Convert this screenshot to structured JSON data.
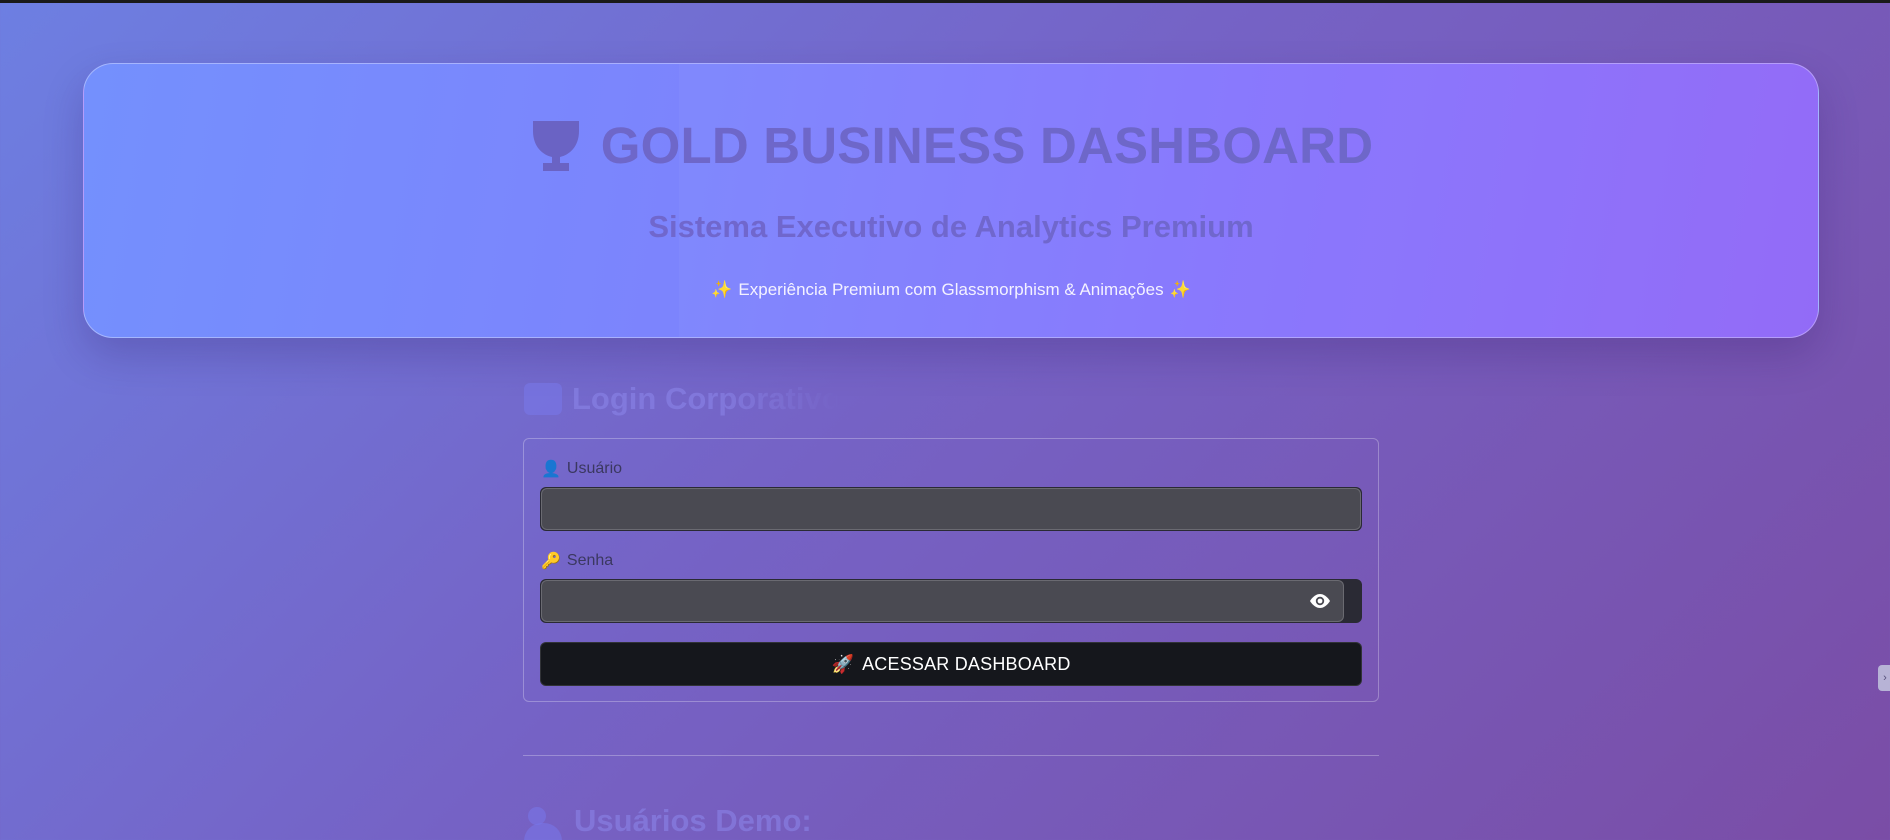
{
  "hero": {
    "title": "GOLD BUSINESS DASHBOARD",
    "subtitle": "Sistema Executivo de Analytics Premium",
    "tagline": "Experiência Premium com Glassmorphism & Animações",
    "sparkle_glyph": "✨"
  },
  "login": {
    "heading": "Login Corporativo",
    "user_label": "Usuário",
    "user_icon": "👤",
    "user_value": "",
    "password_label": "Senha",
    "password_icon": "🔑",
    "password_value": "",
    "submit_icon": "🚀",
    "submit_label": "ACESSAR DASHBOARD"
  },
  "demo": {
    "heading": "Usuários Demo:"
  },
  "side_handle": {
    "glyph": "›"
  },
  "colors": {
    "hero_title": "#6e67c9",
    "button_bg": "#15171c",
    "input_bg": "#4a4a52"
  },
  "icons": [
    "trophy-icon",
    "sparkle-icon",
    "folder-icon",
    "user-icon",
    "key-icon",
    "eye-icon",
    "rocket-icon",
    "users-icon"
  ]
}
